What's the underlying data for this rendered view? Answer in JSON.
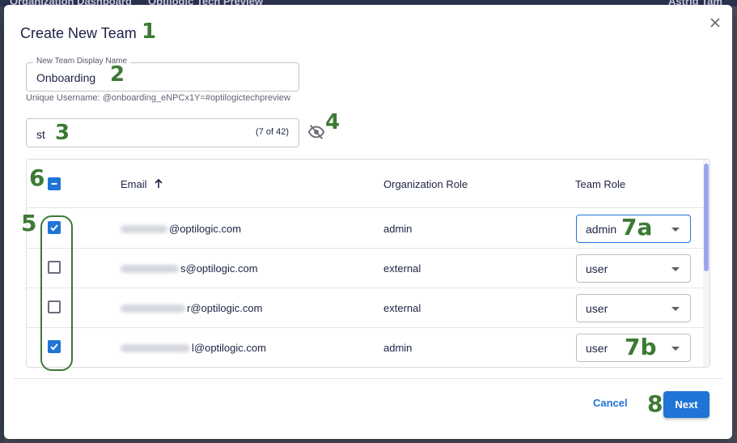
{
  "background": {
    "left_text": "Organization Dashboard",
    "mid_text": "Optilogic Tech Preview",
    "right_text": "Astrid Tam"
  },
  "dialog": {
    "title": "Create New Team",
    "close_icon": "close-icon"
  },
  "team_name": {
    "label": "New Team Display Name",
    "value": "Onboarding",
    "hint": "Unique Username: @onboarding_eNPCx1Y=#optilogictechpreview"
  },
  "search": {
    "value": "st",
    "count": "(7 of 42)",
    "visibility_icon": "eye-off-icon"
  },
  "table": {
    "headers": {
      "email": "Email",
      "org_role": "Organization Role",
      "team_role": "Team Role"
    },
    "sort_icon": "arrow-up-icon",
    "rows": [
      {
        "email_domain": "@optilogic.com",
        "org_role": "admin",
        "team_role": "admin",
        "selected": true
      },
      {
        "email_domain": "s@optilogic.com",
        "org_role": "external",
        "team_role": "user",
        "selected": false
      },
      {
        "email_domain": "r@optilogic.com",
        "org_role": "external",
        "team_role": "user",
        "selected": false
      },
      {
        "email_domain": "l@optilogic.com",
        "org_role": "admin",
        "team_role": "user",
        "selected": true
      }
    ]
  },
  "actions": {
    "cancel": "Cancel",
    "next": "Next"
  },
  "callouts": {
    "c1": "1",
    "c2": "2",
    "c3": "3",
    "c4": "4",
    "c5": "5",
    "c6": "6",
    "c7a": "7a",
    "c7b": "7b",
    "c8": "8"
  },
  "colors": {
    "accent": "#1f74d6",
    "callout_green": "#3d7a35",
    "title_navy": "#1c2244",
    "scrollbar": "#9ea5ee"
  }
}
